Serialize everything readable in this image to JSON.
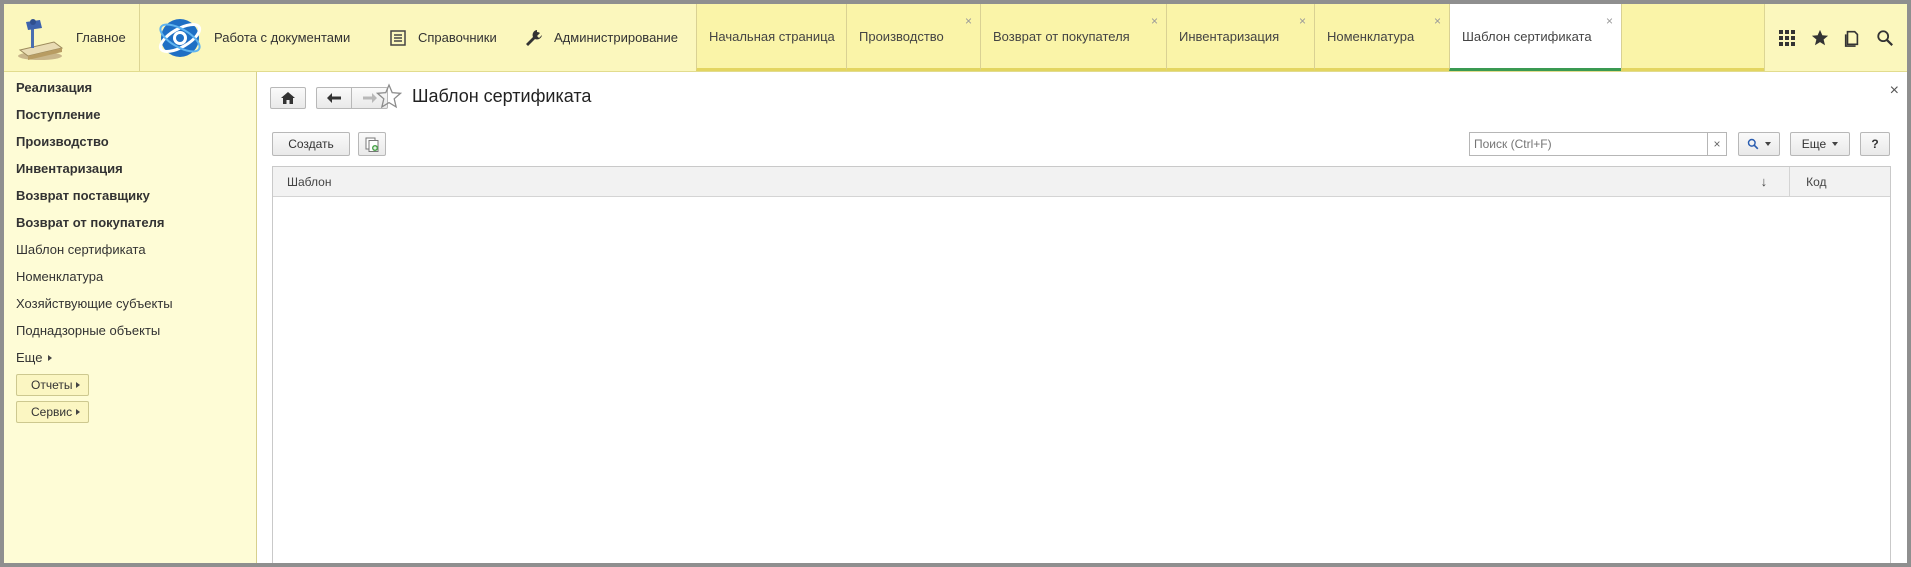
{
  "topbar": {
    "home_label": "Главное",
    "sections": [
      {
        "label": "Работа с документами",
        "icon": "globe-logo-icon"
      },
      {
        "label": "Справочники",
        "icon": "list-icon"
      },
      {
        "label": "Администрирование",
        "icon": "wrench-icon"
      }
    ],
    "tabs": [
      {
        "label": "Начальная страница",
        "closable": false,
        "active": false
      },
      {
        "label": "Производство",
        "closable": true,
        "active": false
      },
      {
        "label": "Возврат от покупателя",
        "closable": true,
        "active": false
      },
      {
        "label": "Инвентаризация",
        "closable": true,
        "active": false
      },
      {
        "label": "Номенклатура",
        "closable": true,
        "active": false
      },
      {
        "label": "Шаблон сертификата",
        "closable": true,
        "active": true
      }
    ],
    "right_icons": [
      "apps-grid-icon",
      "star-icon",
      "history-icon",
      "search-icon"
    ],
    "tab_close_glyph": "×"
  },
  "sidebar": {
    "items": [
      {
        "label": "Реализация",
        "bold": true
      },
      {
        "label": "Поступление",
        "bold": true
      },
      {
        "label": "Производство",
        "bold": true
      },
      {
        "label": "Инвентаризация",
        "bold": true
      },
      {
        "label": "Возврат поставщику",
        "bold": true
      },
      {
        "label": "Возврат от покупателя",
        "bold": true
      },
      {
        "label": "Шаблон сертификата",
        "bold": false
      },
      {
        "label": "Номенклатура",
        "bold": false
      },
      {
        "label": "Хозяйствующие субъекты",
        "bold": false
      },
      {
        "label": "Поднадзорные объекты",
        "bold": false
      }
    ],
    "more_label": "Еще",
    "reports_label": "Отчеты",
    "service_label": "Сервис"
  },
  "main": {
    "title": "Шаблон сертификата",
    "close_glyph": "×",
    "create_label": "Создать",
    "search_placeholder": "Поиск (Ctrl+F)",
    "search_clear": "×",
    "more_label": "Еще",
    "help_label": "?",
    "columns": [
      {
        "label": "Шаблон",
        "sort": "↓"
      },
      {
        "label": "Код"
      }
    ]
  },
  "colors": {
    "topbar_bg": "#fbf7bd",
    "sidebar_bg": "#fefcd6",
    "active_tab_underline": "#3a9a52"
  }
}
